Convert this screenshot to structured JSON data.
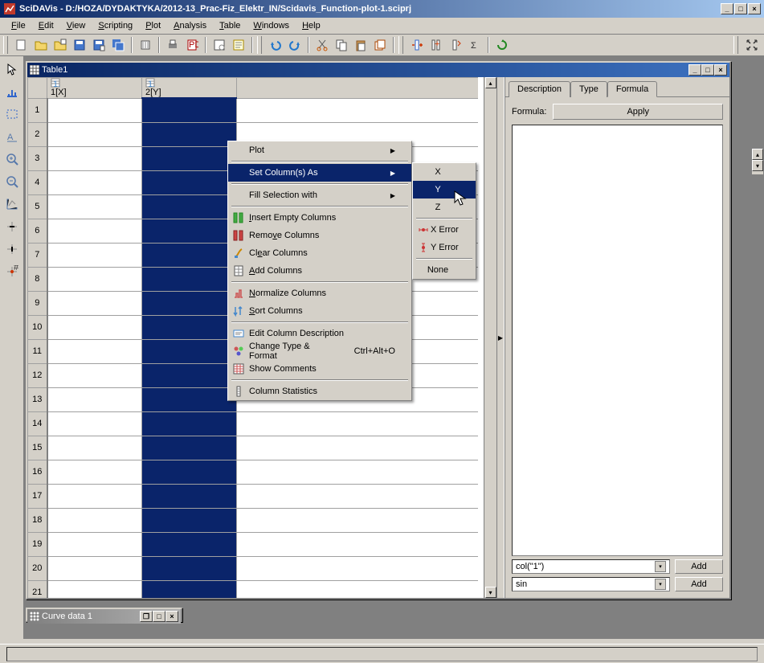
{
  "window": {
    "title": "SciDAVis - D:/HOZA/DYDAKTYKA/2012-13_Prac-Fiz_Elektr_IN/Scidavis_Function-plot-1.sciprj"
  },
  "menu": {
    "file": "File",
    "edit": "Edit",
    "view": "View",
    "scripting": "Scripting",
    "plot": "Plot",
    "analysis": "Analysis",
    "table": "Table",
    "windows": "Windows",
    "help": "Help"
  },
  "subwin": {
    "table_title": "Table1",
    "curve_title": "Curve data 1"
  },
  "columns": {
    "x": "1[X]",
    "y": "2[Y]"
  },
  "rows": [
    "1",
    "2",
    "3",
    "4",
    "5",
    "6",
    "7",
    "8",
    "9",
    "10",
    "11",
    "12",
    "13",
    "14",
    "15",
    "16",
    "17",
    "18",
    "19",
    "20",
    "21"
  ],
  "ctx": {
    "plot": "Plot",
    "set_as": "Set Column(s) As",
    "fill": "Fill Selection with",
    "insert": "Insert Empty Columns",
    "remove": "Remove Columns",
    "clear": "Clear Columns",
    "add": "Add Columns",
    "normalize": "Normalize Columns",
    "sort": "Sort Columns",
    "edit_desc": "Edit Column Description",
    "change_type": "Change Type & Format",
    "change_type_shortcut": "Ctrl+Alt+O",
    "show_comments": "Show Comments",
    "col_stats": "Column Statistics"
  },
  "submenu": {
    "x": "X",
    "y": "Y",
    "z": "Z",
    "xerr": "X Error",
    "yerr": "Y Error",
    "none": "None"
  },
  "panel": {
    "tab_desc": "Description",
    "tab_type": "Type",
    "tab_formula": "Formula",
    "formula_label": "Formula:",
    "apply": "Apply",
    "col_dd": "col(\"1\")",
    "fn_dd": "sin",
    "add": "Add"
  }
}
